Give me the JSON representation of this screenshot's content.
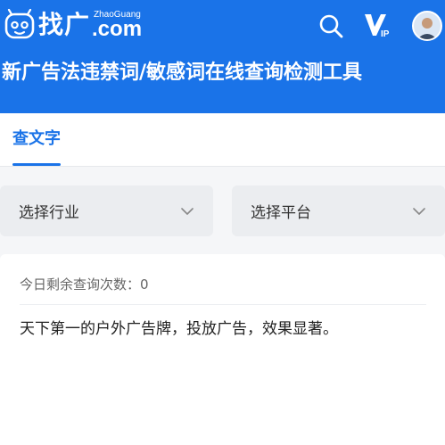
{
  "header": {
    "brand_cn": "找广",
    "brand_en": "ZhaoGuang",
    "brand_com": ".com",
    "page_title": "新广告法违禁词/敏感词在线查询检测工具",
    "icons": {
      "search": "search-icon",
      "vip": "vip-icon",
      "avatar": "user-avatar"
    }
  },
  "tabs": [
    {
      "label": "查文字",
      "active": true
    }
  ],
  "filters": {
    "industry_placeholder": "选择行业",
    "platform_placeholder": "选择平台"
  },
  "query": {
    "remaining_label": "今日剩余查询次数：",
    "remaining_count": "0",
    "input_value": "天下第一的户外广告牌，投放广告，效果显著。"
  },
  "colors": {
    "brand_blue": "#1a73e8",
    "page_bg": "#f5f6f8",
    "select_bg": "#ebedf0"
  }
}
